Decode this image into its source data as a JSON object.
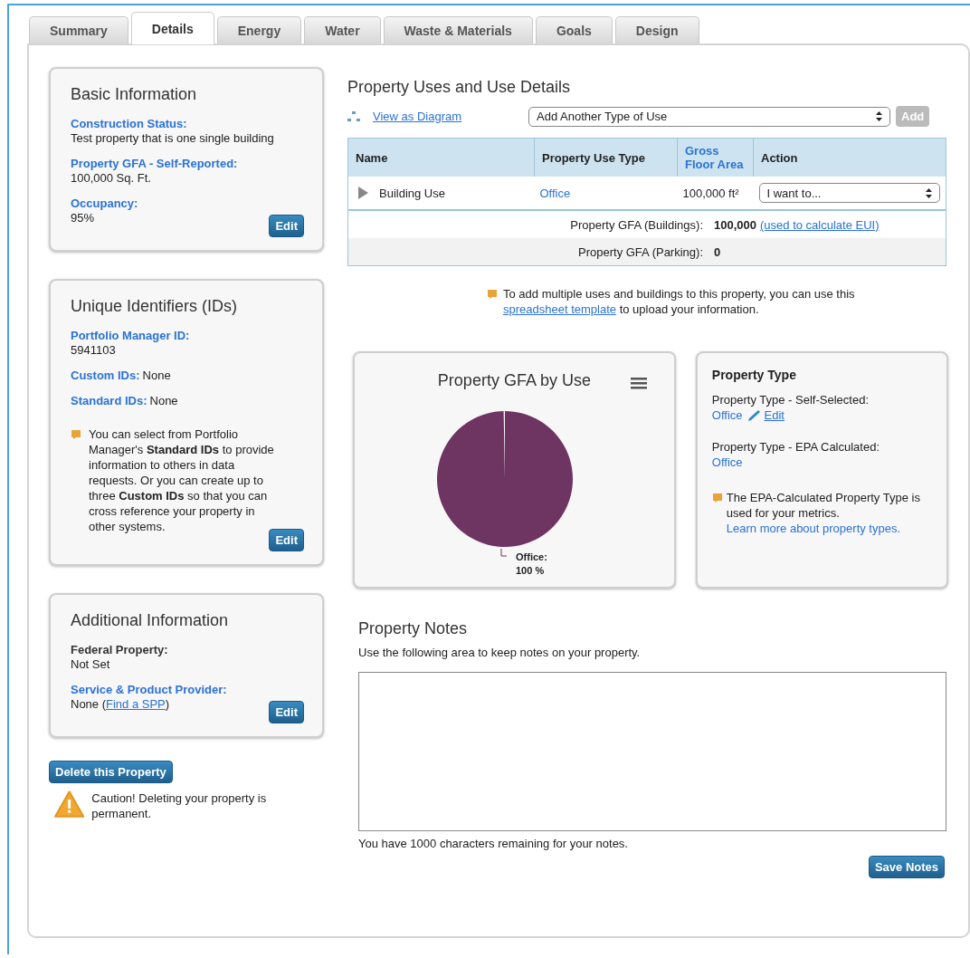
{
  "tabs": [
    {
      "label": "Summary",
      "selected": false
    },
    {
      "label": "Details",
      "selected": true
    },
    {
      "label": "Energy",
      "selected": false
    },
    {
      "label": "Water",
      "selected": false
    },
    {
      "label": "Waste & Materials",
      "selected": false
    },
    {
      "label": "Goals",
      "selected": false
    },
    {
      "label": "Design",
      "selected": false
    }
  ],
  "basic_information": {
    "title": "Basic Information",
    "fields": [
      {
        "label": "Construction Status:",
        "linked": true,
        "inline": false,
        "value": [
          {
            "kind": "text",
            "text": "Test property that is one single building"
          }
        ]
      },
      {
        "label": "Property GFA - Self-Reported:",
        "linked": true,
        "inline": false,
        "value": [
          {
            "kind": "text",
            "text": "100,000 Sq. Ft."
          }
        ]
      },
      {
        "label": "Occupancy:",
        "linked": true,
        "inline": false,
        "value": [
          {
            "kind": "text",
            "text": "95%"
          }
        ]
      }
    ],
    "button": "Edit"
  },
  "unique_identifiers": {
    "title": "Unique Identifiers (IDs)",
    "fields": [
      {
        "label": "Portfolio Manager ID:",
        "linked": true,
        "inline": false,
        "value": [
          {
            "kind": "text",
            "text": "5941103"
          }
        ]
      },
      {
        "label": "Custom IDs:",
        "linked": true,
        "inline": true,
        "value": [
          {
            "kind": "text",
            "text": "None"
          }
        ]
      },
      {
        "label": "Standard IDs:",
        "linked": true,
        "inline": true,
        "value": [
          {
            "kind": "text",
            "text": "None"
          }
        ]
      }
    ],
    "tip": "You can select from Portfolio Manager's **Standard IDs** to provide information to others in data requests. Or you can create up to three **Custom IDs** so that you can cross reference your property in other systems.",
    "button": "Edit"
  },
  "additional_information": {
    "title": "Additional Information",
    "fields": [
      {
        "label": "Federal Property:",
        "linked": false,
        "inline": false,
        "value": [
          {
            "kind": "text",
            "text": "Not Set"
          }
        ]
      },
      {
        "label": "Service & Product Provider:",
        "linked": true,
        "inline": false,
        "value": [
          {
            "kind": "text",
            "text": "None ("
          },
          {
            "kind": "link",
            "text": "Find a SPP"
          },
          {
            "kind": "text",
            "text": ")"
          }
        ]
      }
    ],
    "button": "Edit"
  },
  "delete_button": "Delete this Property",
  "caution": "Caution! Deleting your property is permanent.",
  "property_uses": {
    "title": "Property Uses and Use Details",
    "diagram_link": "View as Diagram",
    "use_select": "Add Another Type of Use",
    "add_button": "Add",
    "columns": [
      {
        "label": "Name",
        "sortable": false
      },
      {
        "label": "Property Use Type",
        "sortable": false
      },
      {
        "label": "Gross Floor Area",
        "sortable": true
      },
      {
        "label": "Action",
        "sortable": false
      }
    ],
    "rows": [
      {
        "name": "Building Use",
        "type": "Office",
        "area": "100,000 ft²",
        "action": "I want to..."
      }
    ],
    "totals": [
      {
        "label": "Property GFA (Buildings):",
        "value": "100,000",
        "link": "(used to calculate EUI)"
      },
      {
        "label": "Property GFA (Parking):",
        "value": "0"
      }
    ],
    "tip": [
      {
        "kind": "text",
        "text": "To add multiple uses and buildings to this property, you can use this "
      },
      {
        "kind": "link",
        "text": "spreadsheet template"
      },
      {
        "kind": "text",
        "text": " to upload your information."
      }
    ]
  },
  "gfa_chart": {
    "chart_data": {
      "type": "pie",
      "title": "Property GFA by Use",
      "categories": [
        "Office"
      ],
      "series": [
        {
          "color": "#6e3462",
          "values": [
            100
          ]
        }
      ]
    },
    "label_separator": ":",
    "value_label": "100 %"
  },
  "property_type": {
    "title": "Property Type",
    "self_selected_label": "Property Type - Self-Selected:",
    "self_selected_value": "Office",
    "edit_link": "Edit",
    "epa_label": "Property Type - EPA Calculated:",
    "epa_value": "Office",
    "tip": "The EPA-Calculated Property Type is used for your metrics.",
    "learn_link": "Learn more about property types."
  },
  "notes": {
    "title": "Property Notes",
    "instruction": "Use the following area to keep notes on your property.",
    "remaining": "You have 1000 characters remaining for your notes.",
    "save_button": "Save Notes"
  }
}
